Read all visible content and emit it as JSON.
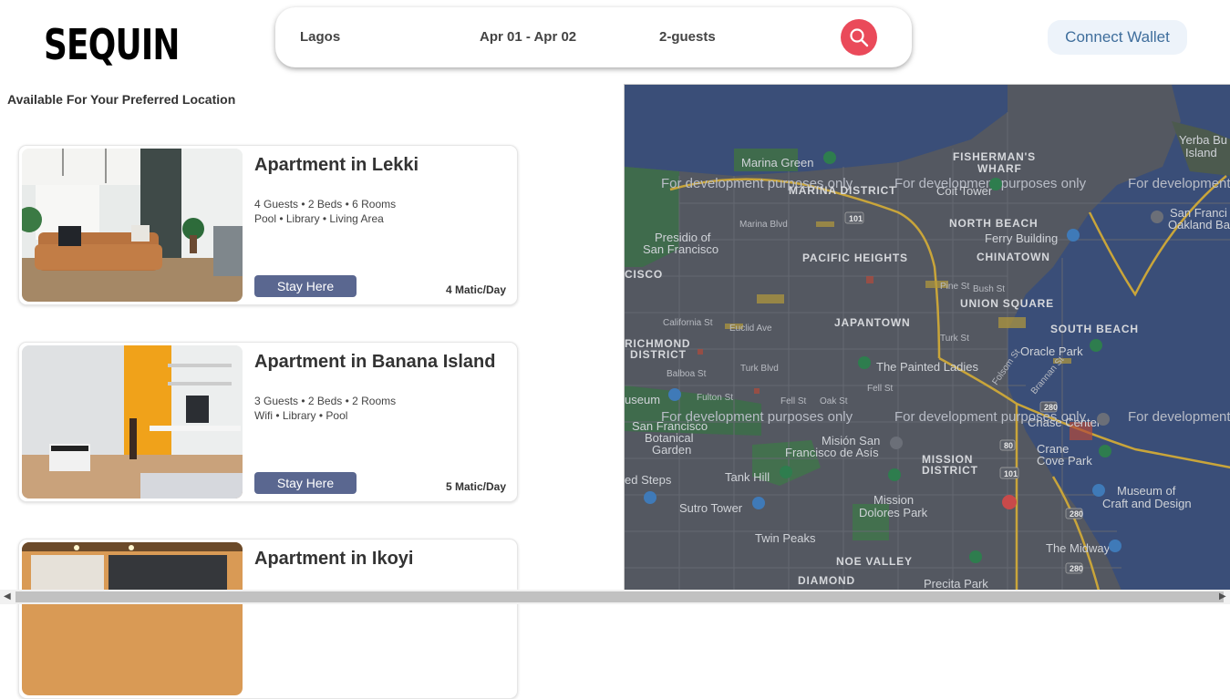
{
  "logo": "SEQUIN",
  "search": {
    "location": "Lagos",
    "dates": "Apr 01 - Apr 02",
    "guests": "2-guests"
  },
  "wallet_label": "Connect Wallet",
  "section_title": "Available For Your Preferred Location",
  "stay_label": "Stay Here",
  "listings": [
    {
      "title": "Apartment in Lekki",
      "details": "4 Guests • 2 Beds • 6 Rooms",
      "amenities": "Pool • Library • Living Area",
      "price": "4 Matic/Day"
    },
    {
      "title": "Apartment in Banana Island",
      "details": "3 Guests • 2 Beds • 2 Rooms",
      "amenities": "Wifi • Library • Pool",
      "price": "5 Matic/Day"
    },
    {
      "title": "Apartment in Ikoyi"
    }
  ],
  "map": {
    "watermark": "For development purposes only",
    "places": {
      "yerba": "Yerba Bu",
      "island": "Island",
      "fishermans": "FISHERMAN'S",
      "wharf": "WHARF",
      "marina_green": "Marina Green",
      "marina_district": "MARINA DISTRICT",
      "coit": "Coit Tower",
      "north_beach": "NORTH BEACH",
      "ferry": "Ferry Building",
      "chinatown": "CHINATOWN",
      "san_fran": "San Franci",
      "oakland": "Oakland Ba",
      "presidio1": "Presidio of",
      "presidio2": "San Francisco",
      "pacific": "PACIFIC HEIGHTS",
      "cisco": "CISCO",
      "union": "UNION SQUARE",
      "south_beach": "SOUTH BEACH",
      "japantown": "JAPANTOWN",
      "richmond1": "RICHMOND",
      "richmond2": "DISTRICT",
      "oracle": "Oracle Park",
      "painted": "The Painted Ladies",
      "useum": "useum",
      "sf_bot1": "San Francisco",
      "sf_bot2": "Botanical",
      "sf_bot3": "Garden",
      "chase": "Chase Center",
      "mision1": "Misión San",
      "mision2": "Francisco de Asís",
      "mission1": "MISSION",
      "mission2": "DISTRICT",
      "crane1": "Crane",
      "crane2": "Cove Park",
      "tank": "Tank Hill",
      "steps": "ed Steps",
      "dolores1": "Mission",
      "dolores2": "Dolores Park",
      "craft1": "Museum of",
      "craft2": "Craft and Design",
      "sutro": "Sutro Tower",
      "twin": "Twin Peaks",
      "midway": "The Midway",
      "noe": "NOE VALLEY",
      "diamond": "DIAMOND",
      "precita": "Precita Park",
      "marina_blvd": "Marina Blvd",
      "california": "California St",
      "euclid": "Euclid Ave",
      "balboa": "Balboa St",
      "turk_blvd": "Turk Blvd",
      "fulton": "Fulton St",
      "fell": "Fell St",
      "oak": "Oak St",
      "turk": "Turk St",
      "pine": "Pine St",
      "bush": "Bush St",
      "folsom": "Folsom St",
      "brannan": "Brannan St",
      "i80": "80",
      "us101a": "101",
      "us101b": "101",
      "i280a": "280",
      "i280b": "280",
      "i280c": "280"
    }
  }
}
